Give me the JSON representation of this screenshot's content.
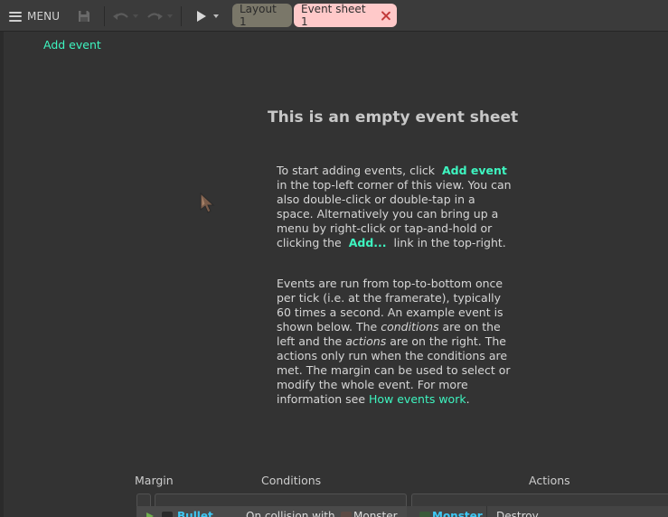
{
  "toolbar": {
    "menu_label": "MENU",
    "tabs": [
      {
        "label": "Layout 1",
        "active": false
      },
      {
        "label": "Event sheet 1",
        "active": true
      }
    ]
  },
  "main": {
    "add_event_link": "Add event",
    "empty_title": "This is an empty event sheet",
    "help1": {
      "a": "To start adding events, click",
      "link_add_event": "Add event",
      "b": "in the top-left corner of this view. You can also double-click or double-tap in a space. Alternatively you can bring up a menu by right-click or tap-and-hold or clicking the",
      "link_add": "Add...",
      "c": "link in the top-right."
    },
    "help2": {
      "a": "Events are run from top-to-bottom once per tick (i.e. at the framerate), typically 60 times a second. An example event is shown below. The",
      "em_conditions": "conditions",
      "b": "are on the left and the",
      "em_actions": "actions",
      "c": "are on the right. The actions only run when the conditions are met. The margin can be used to select or modify the whole event. For more information see",
      "link_how": "How events work",
      "d": "."
    },
    "example": {
      "headers": {
        "margin": "Margin",
        "conditions": "Conditions",
        "actions": "Actions"
      },
      "condition_object": "Bullet",
      "condition_text": "On collision with",
      "condition_target": "Monster",
      "action_object": "Monster",
      "action_text": "Destroy"
    }
  },
  "colors": {
    "background": "#333333",
    "link": "#3ef5c0",
    "object_name": "#3ec8f5",
    "active_tab": "#ffc9c9",
    "inactive_tab": "#7a7769"
  }
}
